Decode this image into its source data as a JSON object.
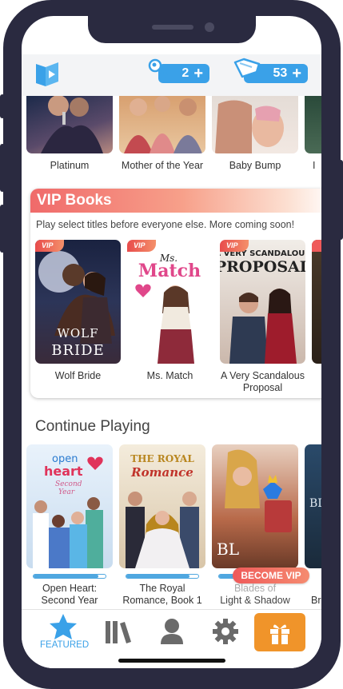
{
  "header": {
    "keys_count": "2",
    "gems_count": "53",
    "plus": "+"
  },
  "top_row": {
    "items": [
      {
        "title": "Platinum"
      },
      {
        "title": "Mother of the Year"
      },
      {
        "title": "Baby Bump"
      },
      {
        "title": "I"
      }
    ]
  },
  "vip": {
    "heading": "VIP Books",
    "subtitle": "Play select titles before everyone else. More coming soon!",
    "badge": "VIP",
    "books": [
      {
        "title": "Wolf Bride",
        "cover_text": "WOLF BRIDE"
      },
      {
        "title": "Ms. Match",
        "cover_text_small": "Ms.",
        "cover_text_big": "Match"
      },
      {
        "title_line1": "A Very Scandalous",
        "title_line2": "Proposal",
        "cover_text_small": "A VERY SCANDALOUS",
        "cover_text_big": "PROPOSAL"
      }
    ]
  },
  "continue": {
    "heading": "Continue Playing",
    "items": [
      {
        "line1": "Open Heart:",
        "line2": "Second Year",
        "cover_a": "open",
        "cover_b": "heart",
        "cover_c": "Second",
        "cover_d": "Year",
        "progress": 0.9
      },
      {
        "line1": "The Royal",
        "line2": "Romance, Book 1",
        "cover_a": "THE ROYAL",
        "cover_b": "Romance",
        "progress": 0.88
      },
      {
        "line1": "Blades of",
        "line2": "Light & Shadow",
        "cover_a": "BL",
        "progress": 0.2
      },
      {
        "line1": "Br",
        "cover_a": "BI",
        "progress": 0.1
      }
    ],
    "become_vip": "BECOME VIP"
  },
  "tabs": {
    "featured_label": "FEATURED"
  },
  "colors": {
    "accent_blue": "#3aa1e8",
    "gift_orange": "#f0942a",
    "vip_red": "#ef5a5a"
  }
}
